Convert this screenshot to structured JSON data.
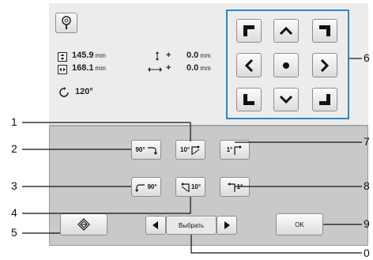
{
  "readouts": {
    "height_value": "145.9",
    "width_value": "168.1",
    "unit": "mm",
    "offset_y_value": "0.0",
    "offset_x_value": "0.0",
    "rotation_value": "120°"
  },
  "rotate_buttons": {
    "cw90": "90°",
    "cw10": "10°",
    "cw1": "1°",
    "ccw90": "90°",
    "ccw10": "10°",
    "ccw1": "1°"
  },
  "bottom": {
    "select_label": "Выбрать",
    "ok_label": "OK"
  },
  "callouts": [
    "1",
    "2",
    "3",
    "4",
    "5",
    "6",
    "7",
    "8",
    "9",
    "0"
  ],
  "colors": {
    "frame_blue": "#2e86c8",
    "panel_gray": "#c9c9c9"
  },
  "icons": {
    "magnifier": "magnifier-icon",
    "rotate": "rotation-icon",
    "reset": "reset-icon"
  }
}
